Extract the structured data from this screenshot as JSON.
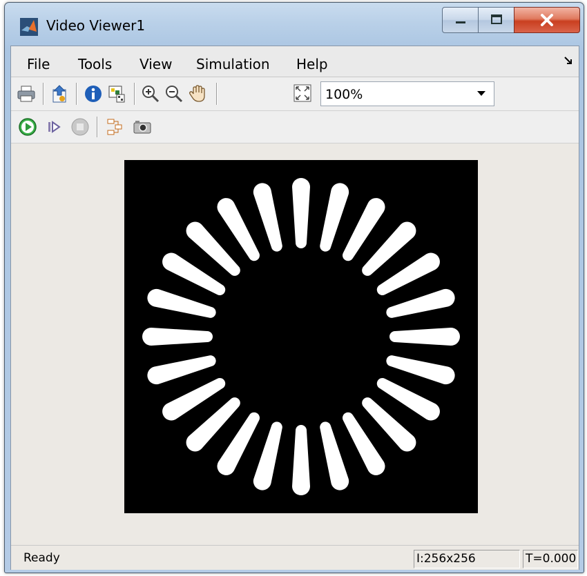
{
  "window": {
    "title": "Video Viewer1",
    "controls": {
      "minimize": "minimize",
      "maximize": "maximize",
      "close": "close"
    }
  },
  "menu": {
    "items": [
      "File",
      "Tools",
      "View",
      "Simulation",
      "Help"
    ]
  },
  "toolbar": {
    "icons": [
      "print-icon",
      "export-to-workspace-icon",
      "info-icon",
      "colormap-icon",
      "zoom-in-icon",
      "zoom-out-icon",
      "pan-hand-icon",
      "fit-to-view-icon"
    ],
    "zoom": {
      "value": "100%"
    }
  },
  "sim_toolbar": {
    "icons": [
      "run-icon",
      "step-forward-icon",
      "stop-icon",
      "highlight-block-icon",
      "snapshot-camera-icon"
    ]
  },
  "video": {
    "spoke_count": 24,
    "foreground": "#ffffff",
    "background": "#000000"
  },
  "status": {
    "text": "Ready",
    "dimensions": "I:256x256",
    "time": "T=0.000"
  }
}
